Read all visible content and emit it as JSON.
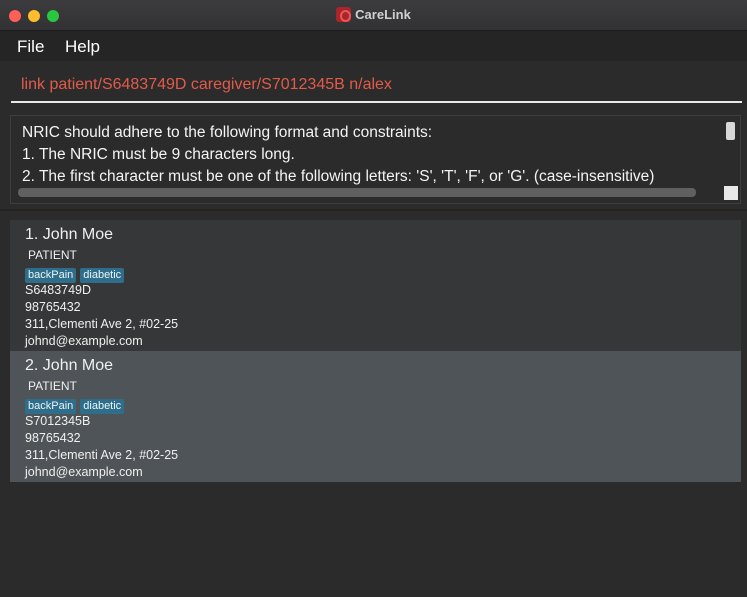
{
  "window": {
    "title": "CareLink"
  },
  "menu": {
    "file": "File",
    "help": "Help"
  },
  "command": {
    "value": "link patient/S6483749D caregiver/S7012345B n/alex"
  },
  "result": {
    "lines": [
      "NRIC should adhere to the following format and constraints:",
      "1. The NRIC must be 9 characters long.",
      "2. The first character must be one of the following letters: 'S', 'T', 'F', or 'G'. (case-insensitive)"
    ]
  },
  "persons": [
    {
      "index_name": "1. John Moe",
      "role": "PATIENT",
      "tags": [
        "backPain",
        "diabetic"
      ],
      "nric": "S6483749D",
      "phone": "98765432",
      "address": "311,Clementi Ave 2, #02-25",
      "email": "johnd@example.com",
      "selected": false
    },
    {
      "index_name": "2. John Moe",
      "role": "PATIENT",
      "tags": [
        "backPain",
        "diabetic"
      ],
      "nric": "S7012345B",
      "phone": "98765432",
      "address": "311,Clementi Ave 2, #02-25",
      "email": "johnd@example.com",
      "selected": true
    }
  ],
  "colors": {
    "command_text": "#e25b4a",
    "tag_bg": "#2f6e8a",
    "card_bg": "#353738",
    "card_selected_bg": "#4e5457"
  }
}
